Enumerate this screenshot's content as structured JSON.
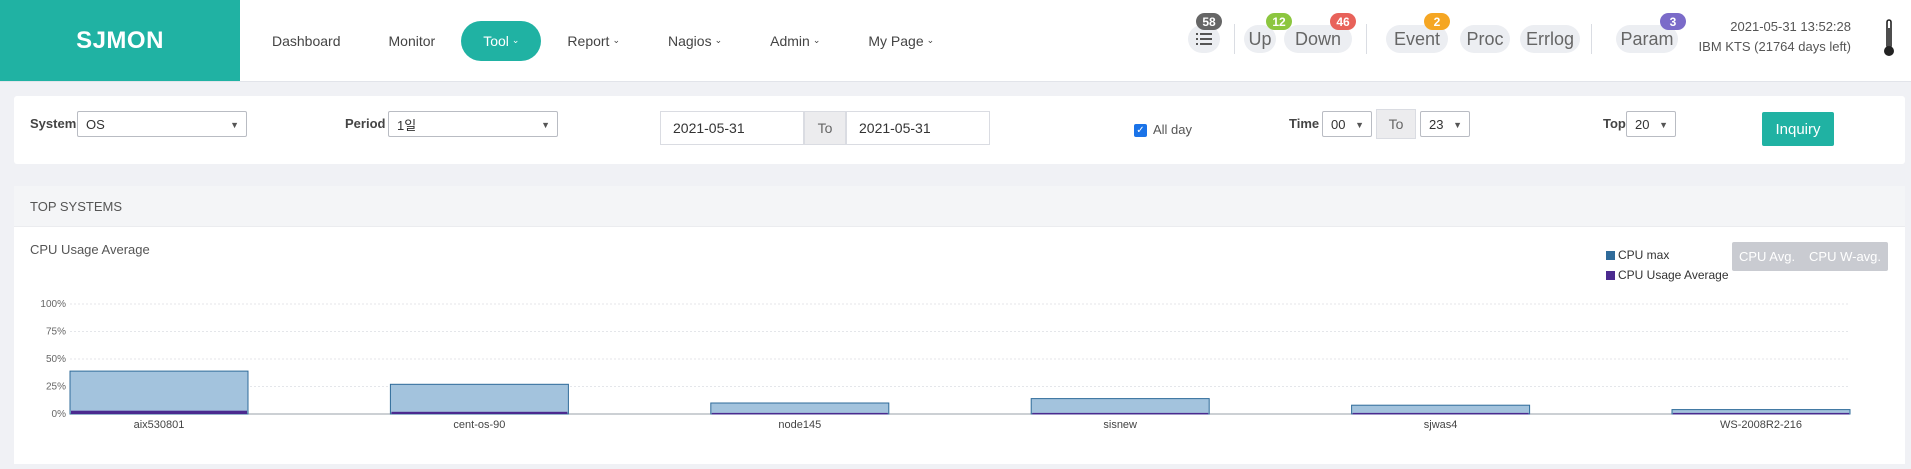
{
  "header": {
    "logo": "SJMON",
    "nav": [
      {
        "label": "Dashboard",
        "caret": false,
        "active": false
      },
      {
        "label": "Monitor",
        "caret": false,
        "active": false
      },
      {
        "label": "Tool",
        "caret": true,
        "active": true
      },
      {
        "label": "Report",
        "caret": true,
        "active": false
      },
      {
        "label": "Nagios",
        "caret": true,
        "active": false
      },
      {
        "label": "Admin",
        "caret": true,
        "active": false
      },
      {
        "label": "My Page",
        "caret": true,
        "active": false
      }
    ],
    "status": {
      "list_count": "58",
      "up_label": "Up",
      "up_count": "12",
      "down_label": "Down",
      "down_count": "46",
      "event_label": "Event",
      "event_count": "2",
      "proc_label": "Proc",
      "errlog_label": "Errlog",
      "param_label": "Param",
      "param_count": "3"
    },
    "datetime": "2021-05-31 13:52:28",
    "license": "IBM KTS (21764 days left)",
    "colors": {
      "brand": "#20b2a3",
      "up": "#8cc63f",
      "down": "#e8625a",
      "event": "#f5a623",
      "param": "#7b6bc9",
      "list": "#666666"
    }
  },
  "filter": {
    "system_label": "System",
    "system_value": "OS",
    "period_label": "Period",
    "period_value": "1일",
    "date_from": "2021-05-31",
    "to_label": "To",
    "date_to": "2021-05-31",
    "allday_label": "All day",
    "allday_checked": true,
    "time_label": "Time",
    "time_from": "00",
    "time_to_label": "To",
    "time_to": "23",
    "top_label": "Top",
    "top_value": "20",
    "inquiry_label": "Inquiry"
  },
  "panel": {
    "title": "TOP SYSTEMS",
    "chart_title": "CPU Usage Average",
    "toggle": [
      "CPU Avg.",
      "CPU W-avg."
    ]
  },
  "chart_data": {
    "type": "bar",
    "title": "CPU Usage Average",
    "categories": [
      "aix530801",
      "cent-os-90",
      "node145",
      "sisnew",
      "sjwas4",
      "WS-2008R2-216"
    ],
    "series": [
      {
        "name": "CPU max",
        "values": [
          39,
          27,
          10,
          14,
          8,
          4
        ],
        "color": "#a3c3dd",
        "stroke": "#2f6b9a"
      },
      {
        "name": "CPU Usage Average",
        "values": [
          3,
          2,
          1,
          1,
          1,
          1
        ],
        "color": "#4b2a8f",
        "stroke": "#4b2a8f"
      }
    ],
    "yticks": [
      "0%",
      "25%",
      "50%",
      "75%",
      "100%"
    ],
    "ylim": [
      0,
      100
    ],
    "grid": true,
    "legend_position": "top-right"
  }
}
